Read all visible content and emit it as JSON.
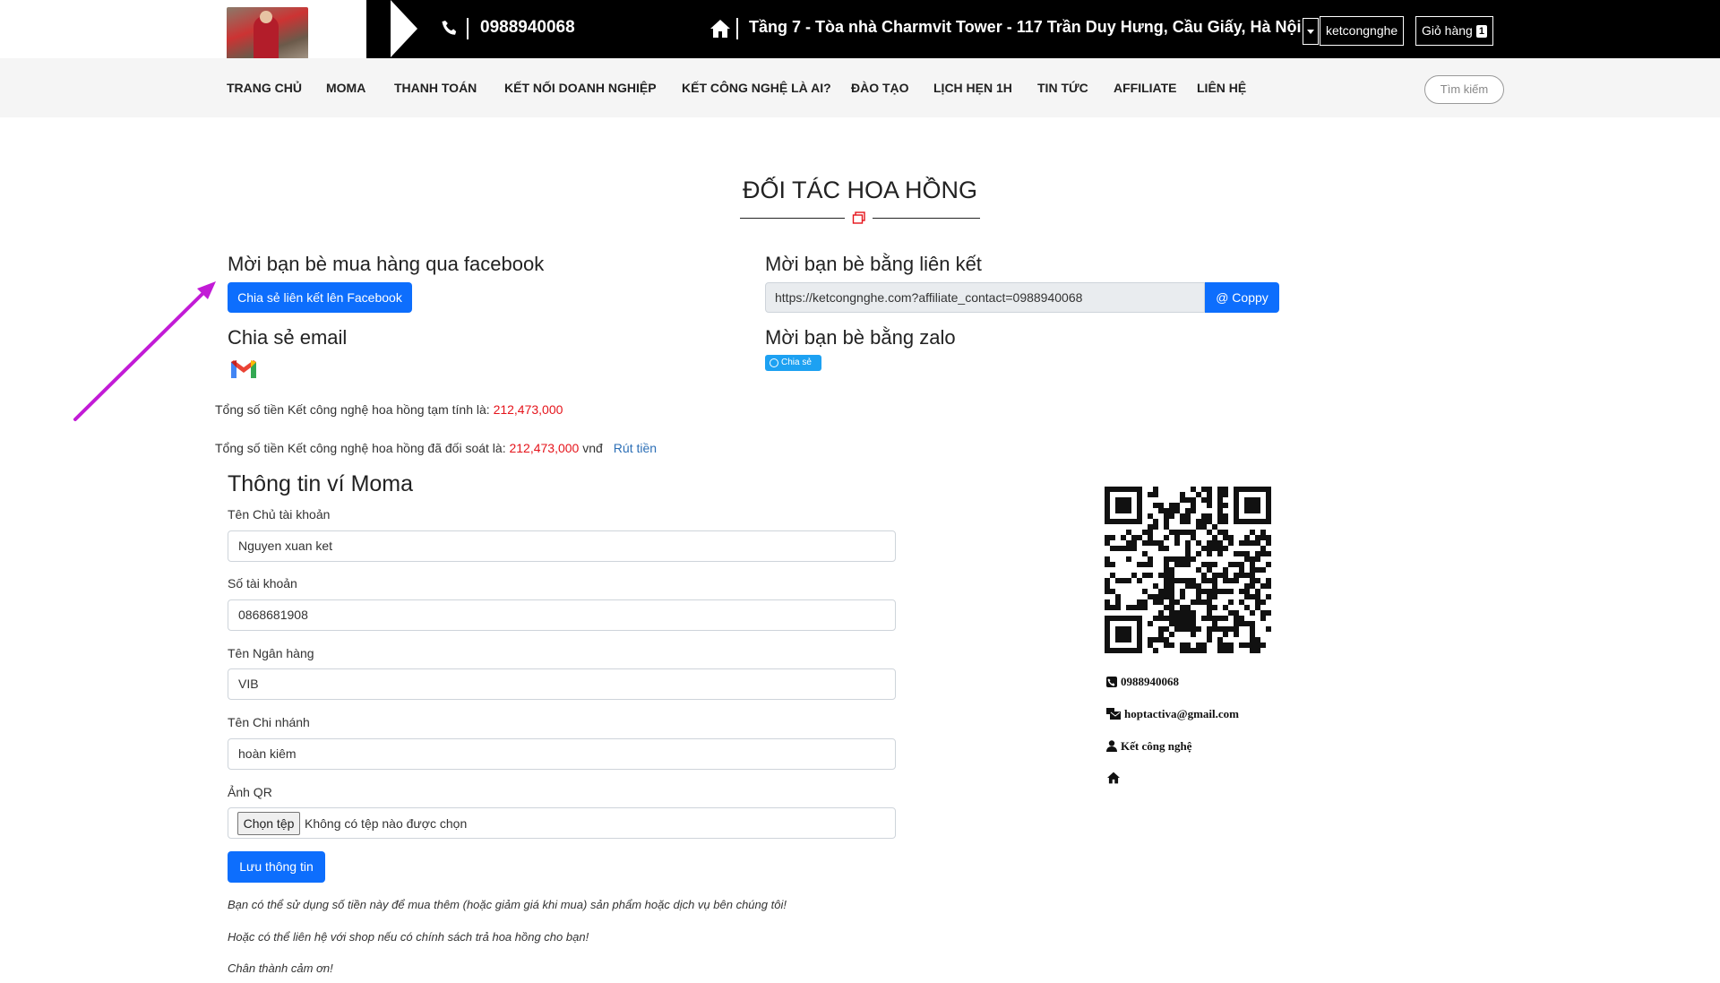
{
  "header": {
    "phone": "0988940068",
    "address": "Tầng 7 - Tòa nhà Charmvit Tower - 117 Trần Duy Hưng, Cầu Giấy, Hà Nội",
    "user": "ketcongnghe",
    "cart_label": "Giỏ hàng",
    "cart_count": "1"
  },
  "nav": {
    "items": [
      "TRANG CHỦ",
      "MOMA",
      "THANH TOÁN",
      "KẾT NỐI DOANH NGHIỆP",
      "KẾT CÔNG NGHỆ LÀ AI?",
      "ĐÀO TẠO",
      "LỊCH HẸN 1H",
      "TIN TỨC",
      "AFFILIATE",
      "LIÊN HỆ"
    ],
    "search_label": "Tìm kiếm"
  },
  "page": {
    "title": "ĐỐI TÁC HOA HỒNG"
  },
  "share": {
    "facebook_heading": "Mời bạn bè mua hàng qua facebook",
    "facebook_button": "Chia sẻ liên kết lên Facebook",
    "email_heading": "Chia sẻ email",
    "link_heading": "Mời bạn bè bằng liên kết",
    "link_value": "https://ketcongnghe.com?affiliate_contact=0988940068",
    "copy_button": "@ Coppy",
    "zalo_heading": "Mời bạn bè bằng zalo",
    "zalo_button": "Chia sẻ"
  },
  "commission": {
    "pending_label": "Tổng số tiền Kết công nghệ hoa hồng tạm tính là: ",
    "pending_amount": "212,473,000",
    "settled_label": "Tổng số tiền Kết công nghệ hoa hồng đã đối soát là: ",
    "settled_amount": "212,473,000",
    "settled_unit": " vnđ",
    "withdraw_link": "Rút tiền"
  },
  "wallet": {
    "heading": "Thông tin ví Moma",
    "owner_label": "Tên Chủ tài khoản",
    "owner_value": "Nguyen xuan ket",
    "account_label": "Số tài khoản",
    "account_value": "0868681908",
    "bank_label": "Tên Ngân hàng",
    "bank_value": "VIB",
    "branch_label": "Tên Chi nhánh",
    "branch_value": "hoàn kiêm",
    "qr_label": "Ảnh QR",
    "file_button": "Chọn tệp",
    "file_none": "Không có tệp nào được chọn",
    "save_button": "Lưu thông tin"
  },
  "notes": [
    "Bạn có thể sử dụng số tiền này để mua thêm (hoặc giảm giá khi mua) sản phẩm hoặc dịch vụ bên chúng tôi!",
    "Hoặc có thể liên hệ với shop nếu có chính sách trả hoa hồng cho bạn!",
    "Chân thành cảm ơn!"
  ],
  "contact": {
    "phone": "0988940068",
    "email": "hoptactiva@gmail.com",
    "name": "Kết công nghệ"
  },
  "colors": {
    "primary": "#0d6efd",
    "amount": "#e5141b",
    "annotation_arrow": "#c21bd6"
  }
}
